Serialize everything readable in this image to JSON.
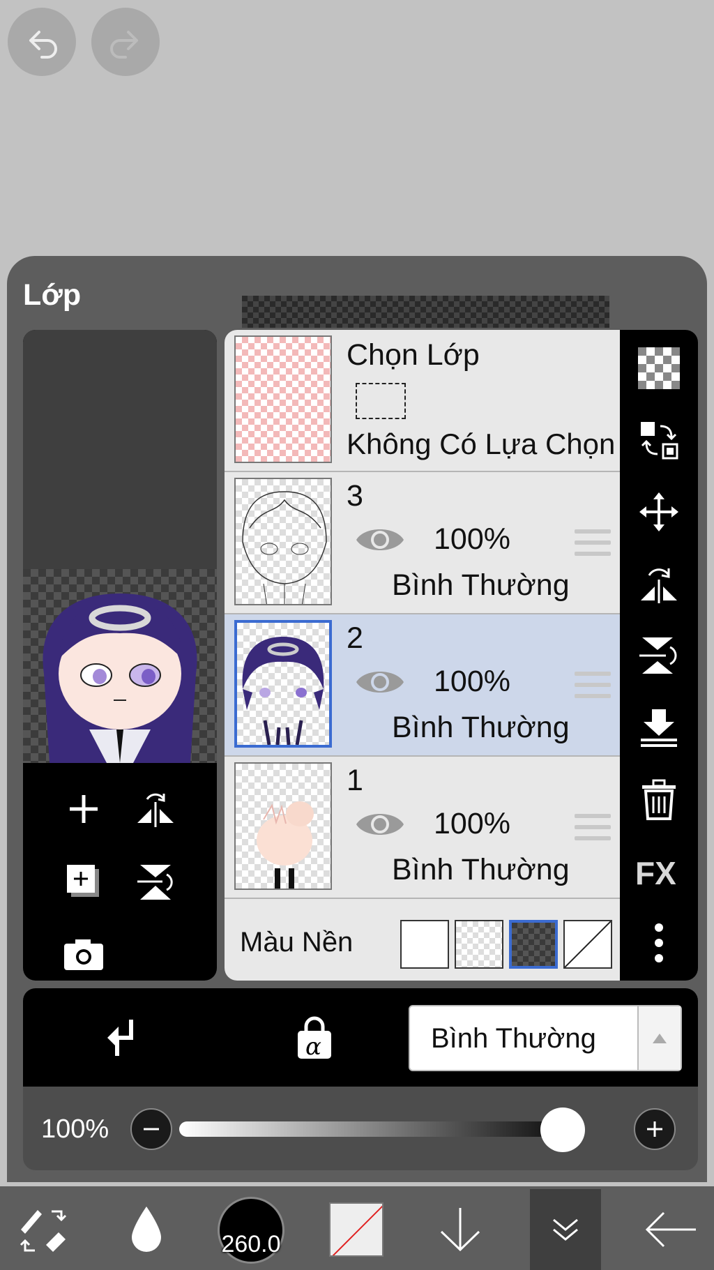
{
  "panel": {
    "title": "Lớp"
  },
  "selection_layer": {
    "title": "Chọn Lớp",
    "status": "Không Có Lựa Chọn"
  },
  "layers": [
    {
      "number": "3",
      "opacity": "100%",
      "blend": "Bình Thường",
      "selected": false
    },
    {
      "number": "2",
      "opacity": "100%",
      "blend": "Bình Thường",
      "selected": true
    },
    {
      "number": "1",
      "opacity": "100%",
      "blend": "Bình Thường",
      "selected": false
    }
  ],
  "background": {
    "label": "Màu Nền",
    "options": [
      "white",
      "transparent",
      "dark-checker",
      "none"
    ],
    "selected": "dark-checker"
  },
  "blend_bar": {
    "mode": "Bình Thường"
  },
  "opacity_bar": {
    "value": "100%",
    "level": 1.0
  },
  "toolbar": {
    "brush_size": "260.0"
  },
  "colors": {
    "accent": "#3b6bd1",
    "selected_row": "#cdd7ea",
    "panel": "#5d5d5d"
  },
  "icons": [
    "undo-icon",
    "redo-icon",
    "add-layer-icon",
    "flip-horizontal-icon",
    "duplicate-layer-icon",
    "flip-vertical-icon",
    "camera-icon",
    "eye-icon",
    "drag-handle-icon",
    "checker-icon",
    "swap-icon",
    "move-icon",
    "rotate-flip-icon",
    "merge-down-icon",
    "trash-icon",
    "fx-icon",
    "more-icon",
    "clipping-icon",
    "alpha-lock-icon",
    "brush-eraser-icon",
    "drop-icon",
    "arrow-down-icon",
    "double-chevron-down-icon",
    "arrow-left-icon"
  ]
}
